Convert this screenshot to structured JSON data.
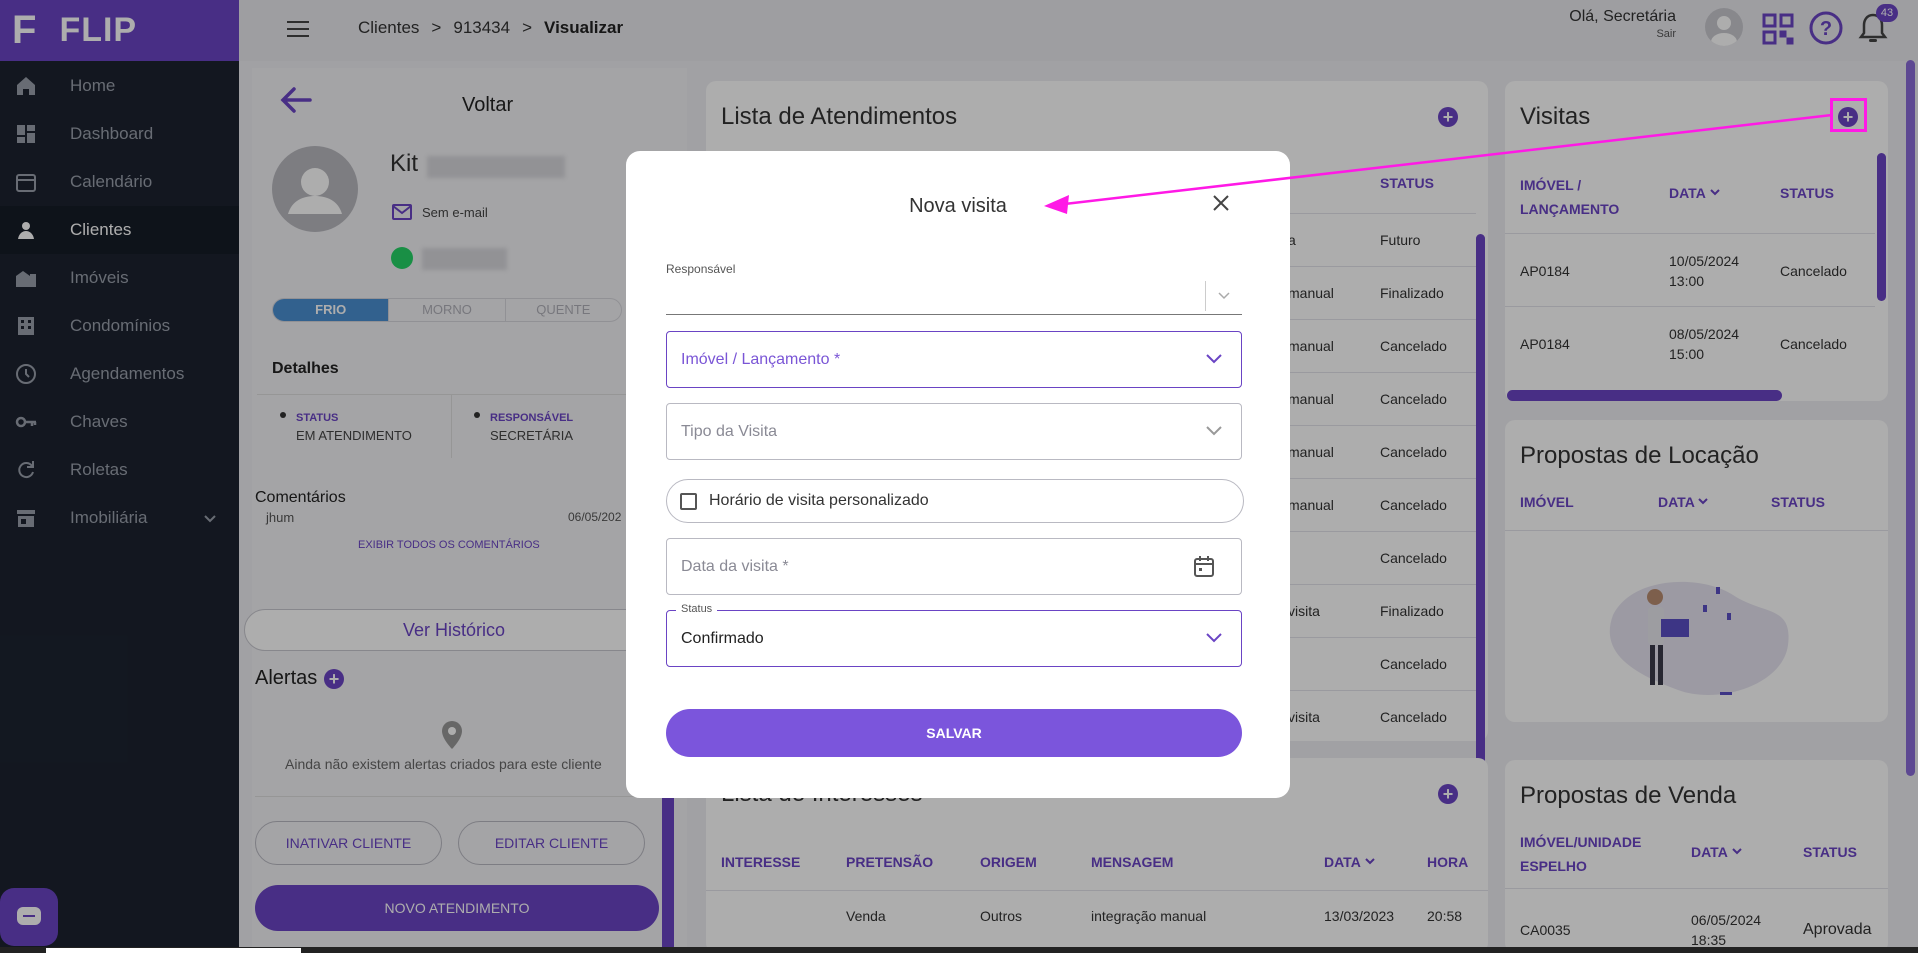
{
  "app": {
    "logo_text": "FLIP",
    "brand": "#6a44c4",
    "sidebar_bg": "#1c2330"
  },
  "sidebar": {
    "items": [
      {
        "label": "Home",
        "icon": "home-icon"
      },
      {
        "label": "Dashboard",
        "icon": "dashboard-icon"
      },
      {
        "label": "Calendário",
        "icon": "calendar-icon"
      },
      {
        "label": "Clientes",
        "icon": "person-icon",
        "active": true
      },
      {
        "label": "Imóveis",
        "icon": "building-icon"
      },
      {
        "label": "Condomínios",
        "icon": "apartment-icon"
      },
      {
        "label": "Agendamentos",
        "icon": "clock-icon"
      },
      {
        "label": "Chaves",
        "icon": "key-icon"
      },
      {
        "label": "Roletas",
        "icon": "refresh-icon"
      },
      {
        "label": "Imobiliária",
        "icon": "store-icon"
      }
    ]
  },
  "header": {
    "breadcrumb": [
      "Clientes",
      "913434",
      "Visualizar"
    ],
    "greeting": "Olá, Secretária",
    "logout": "Sair",
    "notifications": "43"
  },
  "client": {
    "back_label": "Voltar",
    "name": "Kit",
    "email": "Sem e-mail",
    "temperature": [
      "FRIO",
      "MORNO",
      "QUENTE"
    ],
    "details_label": "Detalhes",
    "status_label": "STATUS",
    "status_value": "EM ATENDIMENTO",
    "responsavel_label": "RESPONSÁVEL",
    "responsavel_value": "SECRETÁRIA",
    "comments_label": "Comentários",
    "comment_author": "jhum",
    "comment_date": "06/05/202",
    "show_all_comments": "EXIBIR TODOS OS COMENTÁRIOS",
    "history_button": "Ver Histórico",
    "alerts_label": "Alertas",
    "alerts_empty": "Ainda não existem alertas criados para este cliente",
    "inactivate_button": "INATIVAR CLIENTE",
    "edit_button": "EDITAR CLIENTE",
    "new_button": "NOVO ATENDIMENTO"
  },
  "atendimentos": {
    "title": "Lista de Atendimentos",
    "status_header": "STATUS",
    "rows": [
      {
        "origin": "a",
        "status": "Futuro"
      },
      {
        "origin": "manual",
        "status": "Finalizado"
      },
      {
        "origin": "manual",
        "status": "Cancelado"
      },
      {
        "origin": "manual",
        "status": "Cancelado"
      },
      {
        "origin": "manual",
        "status": "Cancelado"
      },
      {
        "origin": "manual",
        "status": "Cancelado"
      },
      {
        "origin": "",
        "status": "Cancelado"
      },
      {
        "origin": "visita",
        "status": "Finalizado"
      },
      {
        "origin": "",
        "status": "Cancelado"
      },
      {
        "origin": "visita",
        "status": "Cancelado"
      }
    ]
  },
  "interesses": {
    "title": "Lista de Interesses",
    "headers": [
      "INTERESSE",
      "PRETENSÃO",
      "ORIGEM",
      "MENSAGEM",
      "DATA",
      "HORA"
    ],
    "row": [
      "",
      "Venda",
      "Outros",
      "integração manual",
      "13/03/2023",
      "20:58"
    ]
  },
  "visitas": {
    "title": "Visitas",
    "headers": [
      "IMÓVEL / LANÇAMENTO",
      "DATA",
      "STATUS"
    ],
    "rows": [
      {
        "imovel": "AP0184",
        "data": "10/05/2024",
        "hora": "13:00",
        "status": "Cancelado"
      },
      {
        "imovel": "AP0184",
        "data": "08/05/2024",
        "hora": "15:00",
        "status": "Cancelado"
      }
    ]
  },
  "locacao": {
    "title": "Propostas de Locação",
    "headers": [
      "IMÓVEL",
      "DATA",
      "STATUS"
    ]
  },
  "venda": {
    "title": "Propostas de Venda",
    "headers": [
      "IMÓVEL/UNIDADE ESPELHO",
      "DATA",
      "STATUS"
    ],
    "row": {
      "imovel": "CA0035",
      "data": "06/05/2024",
      "hora": "18:35",
      "status": "Aprovada"
    }
  },
  "modal": {
    "title": "Nova visita",
    "responsavel_label": "Responsável",
    "imovel_placeholder": "Imóvel / Lançamento *",
    "tipo_placeholder": "Tipo da Visita",
    "horario_label": "Horário de visita personalizado",
    "data_placeholder": "Data da visita *",
    "status_label": "Status",
    "status_value": "Confirmado",
    "save_button": "SALVAR"
  },
  "annotation_color": "#ff19e6"
}
